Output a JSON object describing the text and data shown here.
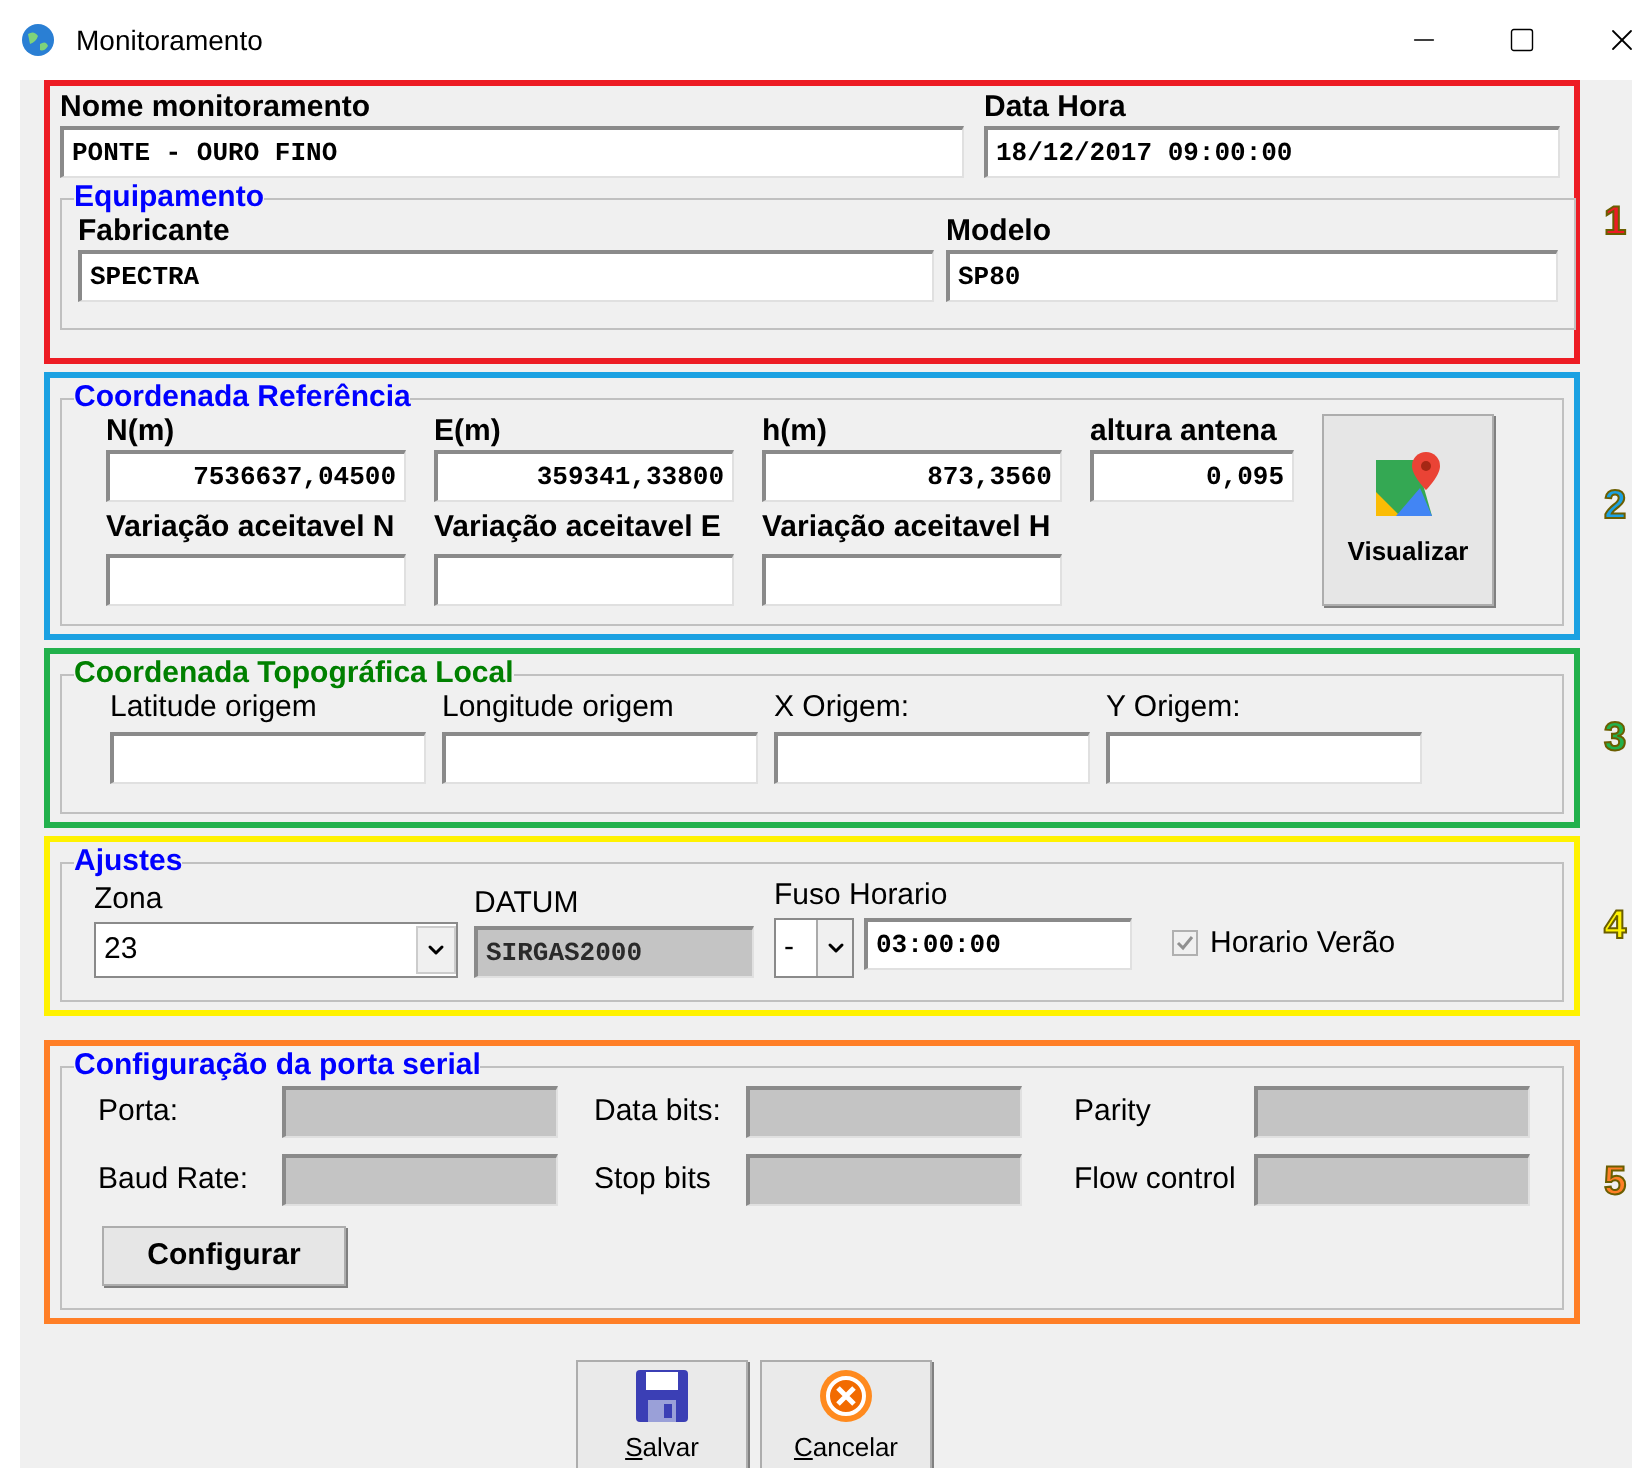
{
  "window": {
    "title": "Monitoramento"
  },
  "annotations": [
    {
      "number": "1",
      "color": "#ed1c24"
    },
    {
      "number": "2",
      "color": "#1ba1e2"
    },
    {
      "number": "3",
      "color": "#22b14c"
    },
    {
      "number": "4",
      "color": "#fff200"
    },
    {
      "number": "5",
      "color": "#ff7f27"
    }
  ],
  "general": {
    "fields": [
      {
        "label": "Nome monitoramento",
        "value": "PONTE - OURO FINO"
      },
      {
        "label": "Data Hora",
        "value": "18/12/2017 09:00:00"
      }
    ],
    "equipment": {
      "title": "Equipamento",
      "fields": [
        {
          "label": "Fabricante",
          "value": "SPECTRA"
        },
        {
          "label": "Modelo",
          "value": "SP80"
        }
      ]
    }
  },
  "reference": {
    "title": "Coordenada Referência",
    "fields": [
      {
        "label": "N(m)",
        "value": "7536637,04500"
      },
      {
        "label": "E(m)",
        "value": "359341,33800"
      },
      {
        "label": "h(m)",
        "value": "873,3560"
      },
      {
        "label": "altura antena",
        "value": "0,095"
      }
    ],
    "tolerances": [
      {
        "label": "Variação aceitavel N"
      },
      {
        "label": "Variação aceitavel E"
      },
      {
        "label": "Variação aceitavel H"
      }
    ],
    "button": "Visualizar"
  },
  "local": {
    "title": "Coordenada Topográfica Local",
    "fields": [
      {
        "label": "Latitude origem"
      },
      {
        "label": "Longitude origem"
      },
      {
        "label": "X Origem:"
      },
      {
        "label": "Y Origem:"
      }
    ]
  },
  "settings": {
    "title": "Ajustes",
    "zone": {
      "label": "Zona",
      "value": "23"
    },
    "datum": {
      "label": "DATUM",
      "value": "SIRGAS2000",
      "disabled": true
    },
    "timezone": {
      "label": "Fuso Horario",
      "sign": "-",
      "value": "03:00:00"
    },
    "dst": {
      "label": "Horario Verão",
      "checked": true,
      "disabled": true
    }
  },
  "serial": {
    "title": "Configuração da porta serial",
    "fields": [
      {
        "label": "Porta:",
        "disabled": true
      },
      {
        "label": "Data bits:",
        "disabled": true
      },
      {
        "label": "Parity",
        "disabled": true
      },
      {
        "label": "Baud Rate:",
        "disabled": true
      },
      {
        "label": "Stop bits",
        "disabled": true
      },
      {
        "label": "Flow control",
        "disabled": true
      }
    ],
    "button": "Configurar"
  },
  "actions": [
    {
      "label": "Salvar",
      "kind": "save"
    },
    {
      "label": "Cancelar",
      "kind": "cancel"
    }
  ]
}
